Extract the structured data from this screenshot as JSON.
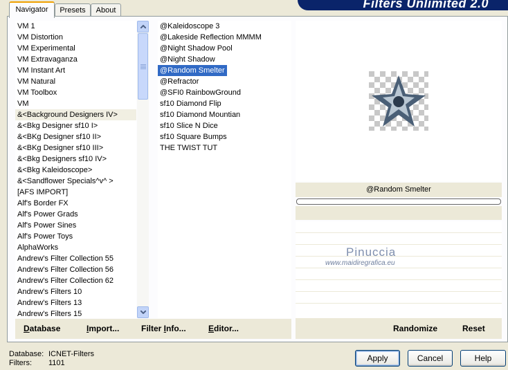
{
  "tabs": [
    {
      "label": "Navigator",
      "active": true
    },
    {
      "label": "Presets",
      "active": false
    },
    {
      "label": "About",
      "active": false
    }
  ],
  "banner": {
    "title": "Filters Unlimited 2.0"
  },
  "categories": [
    "VM 1",
    "VM Distortion",
    "VM Experimental",
    "VM Extravaganza",
    "VM Instant Art",
    "VM Natural",
    "VM Toolbox",
    "VM",
    "&<Background Designers IV>",
    "&<Bkg Designer sf10 I>",
    "&<BKg Designer sf10 II>",
    "&<BKg Designer sf10 III>",
    "&<Bkg Designers sf10 IV>",
    "&<Bkg Kaleidoscope>",
    "&<Sandflower Specials^v^ >",
    "[AFS IMPORT]",
    "Alf's Border FX",
    "Alf's Power Grads",
    "Alf's Power Sines",
    "Alf's Power Toys",
    "AlphaWorks",
    "Andrew's Filter Collection 55",
    "Andrew's Filter Collection 56",
    "Andrew's Filter Collection 62",
    "Andrew's Filters 10",
    "Andrew's Filters 13",
    "Andrew's Filters 15"
  ],
  "categories_highlighted_index": 8,
  "filters": [
    "@Kaleidoscope 3",
    "@Lakeside Reflection MMMM",
    "@Night Shadow Pool",
    "@Night Shadow",
    "@Random Smelter",
    "@Refractor",
    "@SFI0 RainbowGround",
    "sf10 Diamond Flip",
    "sf10 Diamond Mountian",
    "sf10 Slice N Dice",
    "sf10 Square Bumps",
    "THE TWIST TUT"
  ],
  "filters_selected_index": 4,
  "left_buttons": {
    "database": {
      "pre": "",
      "u": "D",
      "post": "atabase"
    },
    "import": {
      "pre": "",
      "u": "I",
      "post": "mport..."
    },
    "filter_info": {
      "pre": "Filter ",
      "u": "I",
      "post": "nfo..."
    },
    "editor": {
      "pre": "",
      "u": "E",
      "post": "ditor..."
    }
  },
  "right_buttons": {
    "randomize": "Randomize",
    "reset": "Reset"
  },
  "preview": {
    "filter_name": "@Random Smelter",
    "progress": 0
  },
  "watermark": {
    "name": "Pinuccia",
    "url": "www.maidiregrafica.eu"
  },
  "footer": {
    "database_label": "Database:",
    "database_value": "ICNET-Filters",
    "filters_label": "Filters:",
    "filters_value": "1101"
  },
  "dialog_buttons": {
    "apply": "Apply",
    "cancel": "Cancel",
    "help": "Help"
  },
  "colors": {
    "selection": "#316ac5",
    "banner": "#0a246a",
    "tab_accent": "#f0a000"
  }
}
